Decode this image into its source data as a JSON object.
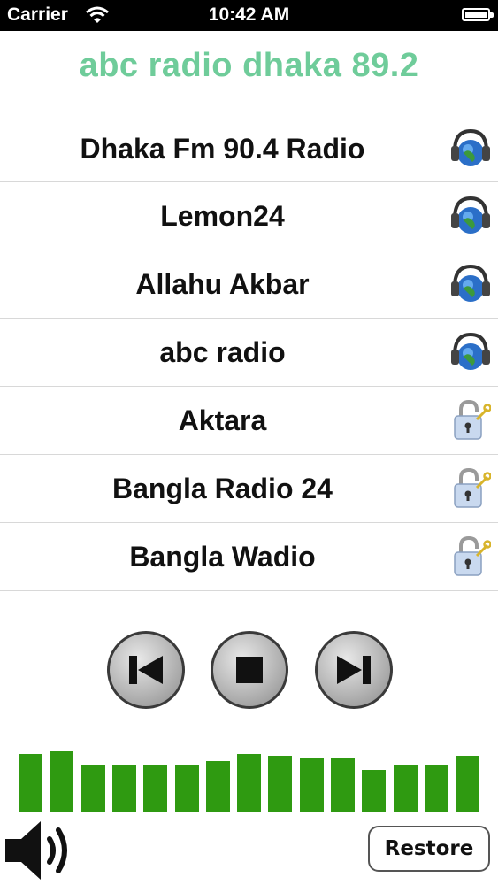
{
  "status_bar": {
    "carrier": "Carrier",
    "time": "10:42 AM"
  },
  "now_playing": {
    "title": "abc radio dhaka  89.2",
    "color": "#6fcc9a"
  },
  "stations": [
    {
      "name": "Dhaka Fm 90.4 Radio",
      "icon": "headphones-globe-icon",
      "locked": false
    },
    {
      "name": "Lemon24",
      "icon": "headphones-globe-icon",
      "locked": false
    },
    {
      "name": "Allahu Akbar",
      "icon": "headphones-globe-icon",
      "locked": false
    },
    {
      "name": "abc radio",
      "icon": "headphones-globe-icon",
      "locked": false
    },
    {
      "name": "Aktara",
      "icon": "padlock-icon",
      "locked": true
    },
    {
      "name": "Bangla Radio 24",
      "icon": "padlock-icon",
      "locked": true
    },
    {
      "name": "Bangla Wadio",
      "icon": "padlock-icon",
      "locked": true
    }
  ],
  "controls": {
    "previous": "previous-track-icon",
    "stop": "stop-icon",
    "next": "next-track-icon"
  },
  "equalizer": {
    "color": "#2f9a11",
    "levels": [
      0.93,
      0.97,
      0.76,
      0.76,
      0.76,
      0.76,
      0.81,
      0.93,
      0.9,
      0.87,
      0.86,
      0.67,
      0.76,
      0.76,
      0.9
    ]
  },
  "restore_label": "Restore"
}
